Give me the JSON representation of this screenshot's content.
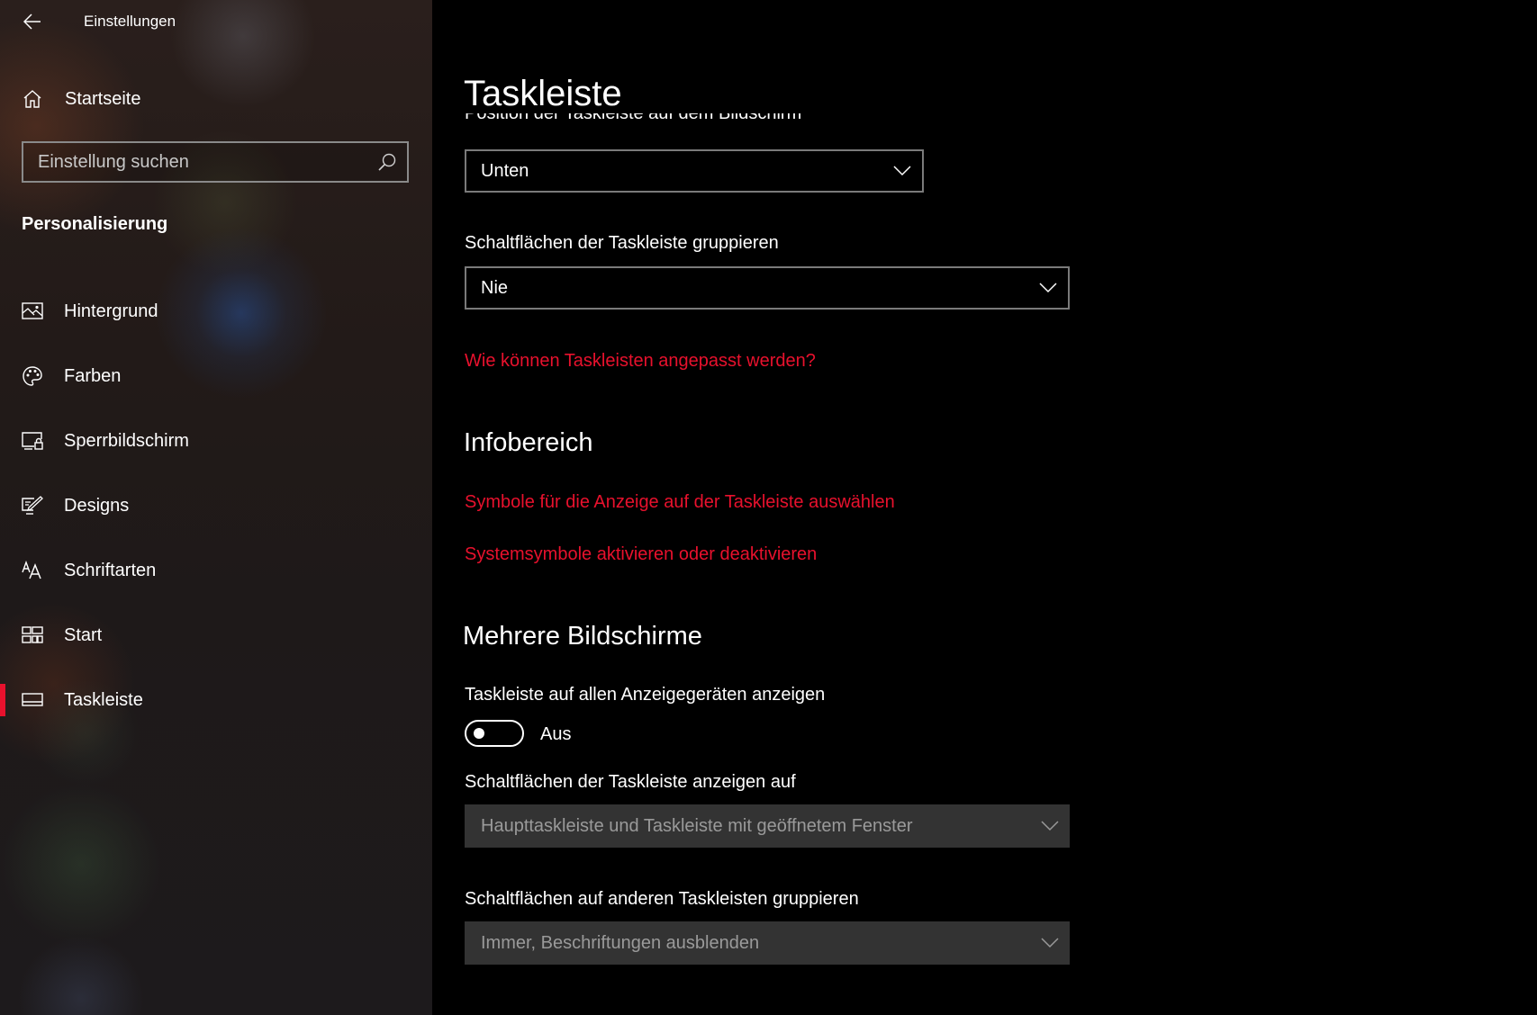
{
  "app": {
    "title": "Einstellungen",
    "accent_color": "#e8112d"
  },
  "sidebar": {
    "home_label": "Startseite",
    "search": {
      "placeholder": "Einstellung suchen",
      "value": ""
    },
    "section_heading": "Personalisierung",
    "items": [
      {
        "label": "Hintergrund",
        "icon": "picture-icon",
        "selected": false
      },
      {
        "label": "Farben",
        "icon": "palette-icon",
        "selected": false
      },
      {
        "label": "Sperrbildschirm",
        "icon": "lock-screen-icon",
        "selected": false
      },
      {
        "label": "Designs",
        "icon": "designs-icon",
        "selected": false
      },
      {
        "label": "Schriftarten",
        "icon": "fonts-icon",
        "selected": false
      },
      {
        "label": "Start",
        "icon": "start-icon",
        "selected": false
      },
      {
        "label": "Taskleiste",
        "icon": "taskbar-icon",
        "selected": true
      }
    ]
  },
  "main": {
    "title": "Taskleiste",
    "position": {
      "label": "Position der Taskleiste auf dem Bildschirm",
      "value": "Unten"
    },
    "grouping": {
      "label": "Schaltflächen der Taskleiste gruppieren",
      "value": "Nie"
    },
    "help_link": "Wie können Taskleisten angepasst werden?",
    "notification_area": {
      "heading": "Infobereich",
      "link_icons": "Symbole für die Anzeige auf der Taskleiste auswählen",
      "link_system_icons": "Systemsymbole aktivieren oder deaktivieren"
    },
    "multiple_displays": {
      "heading": "Mehrere Bildschirme",
      "show_all_label": "Taskleiste auf allen Anzeigegeräten anzeigen",
      "show_all_state": "Aus",
      "show_all_on": false,
      "buttons_on_label": "Schaltflächen der Taskleiste anzeigen auf",
      "buttons_on_value": "Haupttaskleiste und Taskleiste mit geöffnetem Fenster",
      "other_grouping_label": "Schaltflächen auf anderen Taskleisten gruppieren",
      "other_grouping_value": "Immer, Beschriftungen ausblenden"
    }
  }
}
